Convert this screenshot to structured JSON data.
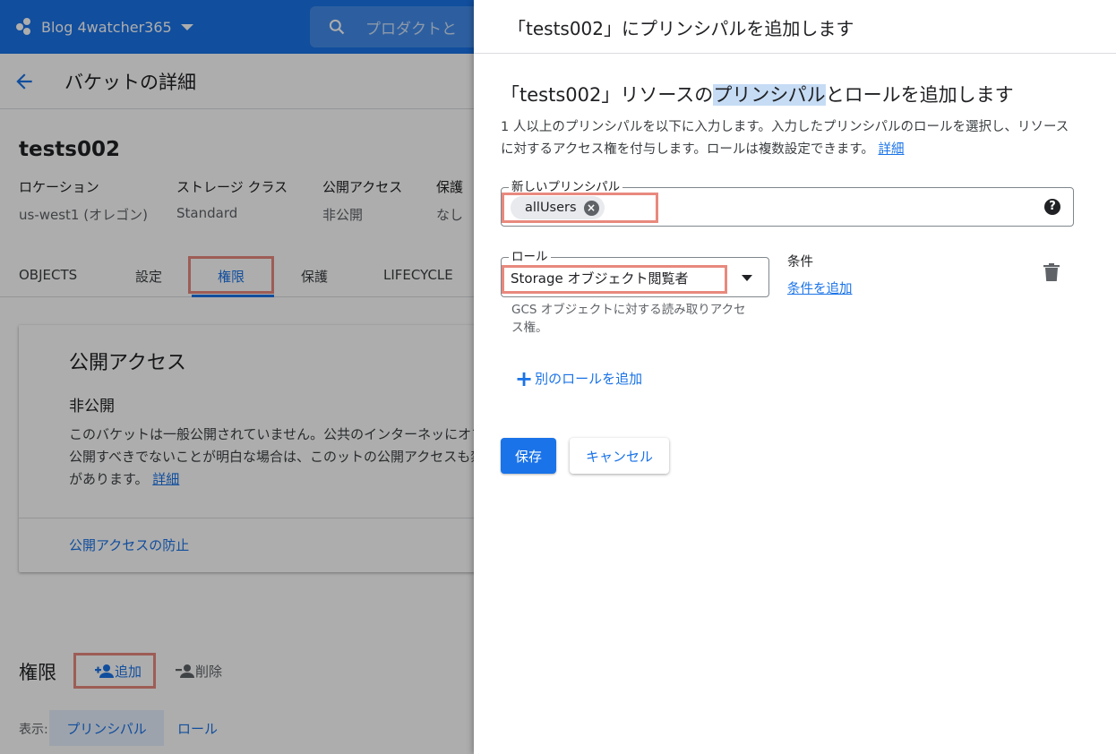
{
  "colors": {
    "primary": "#1a73e8",
    "highlight_box": "#e8897e",
    "overlay": "rgba(0,0,0,0.32)"
  },
  "topbar": {
    "project_name": "Blog 4watcher365",
    "search_placeholder": "プロダクトと"
  },
  "page": {
    "title": "バケットの詳細"
  },
  "bucket": {
    "name": "tests002",
    "meta": [
      {
        "label": "ロケーション",
        "value": "us-west1 (オレゴン)"
      },
      {
        "label": "ストレージ クラス",
        "value": "Standard"
      },
      {
        "label": "公開アクセス",
        "value": "非公開"
      },
      {
        "label": "保護",
        "value": "なし"
      }
    ]
  },
  "tabs": [
    {
      "label": "OBJECTS"
    },
    {
      "label": "設定"
    },
    {
      "label": "権限",
      "active": true
    },
    {
      "label": "保護"
    },
    {
      "label": "LIFECYCLE"
    }
  ],
  "public_access_card": {
    "title": "公開アクセス",
    "status": "非公開",
    "body": "このバケットは一般公開されていません。公共のインターネッにオブジェクトを公開すべきでないことが明白な場合は、このットの公開アクセスも禁止する必要があります。",
    "link": "詳細",
    "action": "公開アクセスの防止"
  },
  "permissions": {
    "title": "権限",
    "add_label": "追加",
    "delete_label": "削除",
    "view_label": "表示:",
    "view_principal": "プリンシパル",
    "view_role": "ロール"
  },
  "panel": {
    "header_title": "「tests002」にプリンシパルを追加します",
    "section_title_pre": "「tests002」リソースの",
    "section_title_hl": "プリンシパル",
    "section_title_post": "とロールを追加します",
    "description": "1 人以上のプリンシパルを以下に入力します。入力したプリンシパルのロールを選択し、リソースに対するアクセス権を付与します。ロールは複数設定できます。",
    "description_link": "詳細",
    "principal_field_label": "新しいプリンシパル",
    "principal_chip": "allUsers",
    "role_field_label": "ロール",
    "role_value": "Storage オブジェクト閲覧者",
    "role_help": "GCS オブジェクトに対する読み取りアクセス権。",
    "condition_label": "条件",
    "condition_add": "条件を追加",
    "add_another_role": "別のロールを追加",
    "save_label": "保存",
    "cancel_label": "キャンセル"
  }
}
